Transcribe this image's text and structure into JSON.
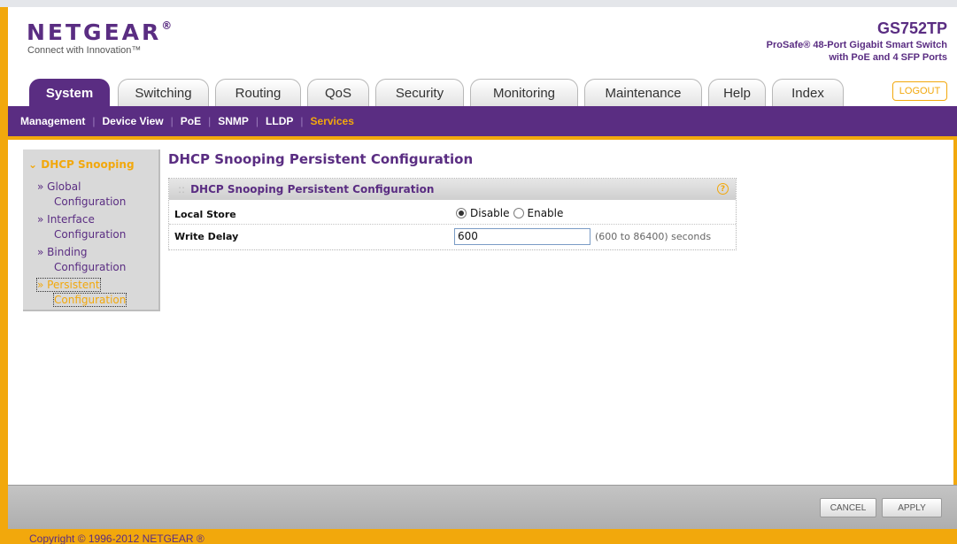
{
  "header": {
    "logo_text": "NETGEAR",
    "logo_mark": "®",
    "tagline": "Connect with Innovation™",
    "model": "GS752TP",
    "model_desc_line1": "ProSafe® 48-Port Gigabit Smart Switch",
    "model_desc_line2": "with PoE and 4 SFP Ports"
  },
  "tabs": [
    {
      "label": "System",
      "active": true
    },
    {
      "label": "Switching"
    },
    {
      "label": "Routing"
    },
    {
      "label": "QoS"
    },
    {
      "label": "Security"
    },
    {
      "label": "Monitoring"
    },
    {
      "label": "Maintenance"
    },
    {
      "label": "Help"
    },
    {
      "label": "Index"
    }
  ],
  "logout_label": "LOGOUT",
  "subnav": [
    {
      "label": "Management"
    },
    {
      "label": "Device View"
    },
    {
      "label": "PoE"
    },
    {
      "label": "SNMP"
    },
    {
      "label": "LLDP"
    },
    {
      "label": "Services",
      "current": true
    }
  ],
  "sidebar": {
    "heading": "DHCP Snooping",
    "items": [
      {
        "line1": "» Global",
        "line2": "Configuration"
      },
      {
        "line1": "» Interface",
        "line2": "Configuration"
      },
      {
        "line1": "» Binding",
        "line2": "Configuration"
      },
      {
        "line1": "» Persistent",
        "line2": "Configuration",
        "current": true
      }
    ]
  },
  "main": {
    "title": "DHCP Snooping Persistent Configuration",
    "panel_title": "DHCP Snooping Persistent Configuration",
    "help_glyph": "?",
    "local_store_label": "Local Store",
    "local_store_options": [
      "Disable",
      "Enable"
    ],
    "local_store_selected": "Disable",
    "write_delay_label": "Write Delay",
    "write_delay_value": "600",
    "write_delay_hint": "(600 to 86400) seconds"
  },
  "footer": {
    "cancel_label": "CANCEL",
    "apply_label": "APPLY",
    "copyright": "Copyright © 1996-2012 NETGEAR ®"
  },
  "colors": {
    "brand_purple": "#5a2d82",
    "accent_orange": "#f2a80c"
  }
}
